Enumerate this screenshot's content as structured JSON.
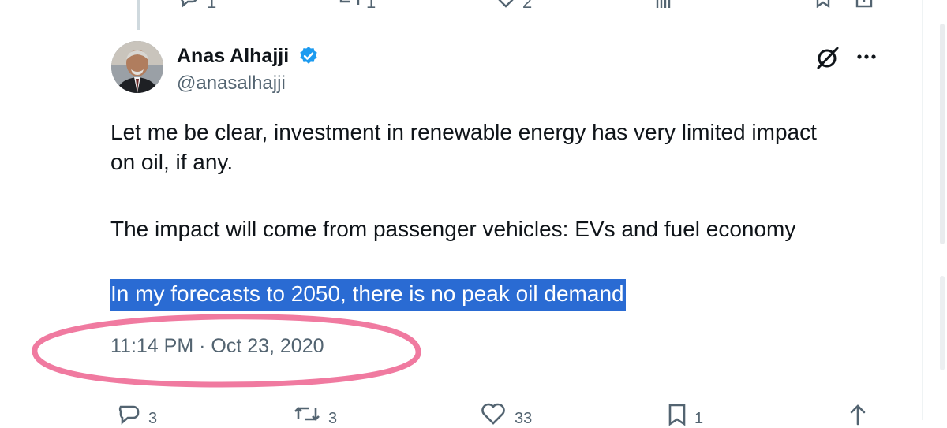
{
  "tweet": {
    "author_name": "Anas Alhajji",
    "author_handle": "@anasalhajji",
    "text_lines": [
      "Let me be clear, investment in renewable energy has very limited impact",
      "on oil, if any.",
      "The impact will come from passenger vehicles: EVs and fuel economy",
      "In my forecasts to 2050, there is no peak oil demand"
    ],
    "timestamp": "11:14 PM · Oct 23, 2020",
    "icons": {
      "verified": "verified-badge-icon",
      "grok": "grok-icon",
      "more": "more-options-icon"
    },
    "actions": {
      "replies": "3",
      "reposts": "3",
      "likes": "33",
      "bookmarks": "1"
    }
  },
  "previous_tweet_actions": {
    "replies": "1",
    "reposts": "1",
    "likes": "2"
  },
  "colors": {
    "accent": "#1d9bf0",
    "selection": "#2a6bd3",
    "annotation_ellipse": "#f07aa0",
    "secondary_text": "#536471"
  }
}
